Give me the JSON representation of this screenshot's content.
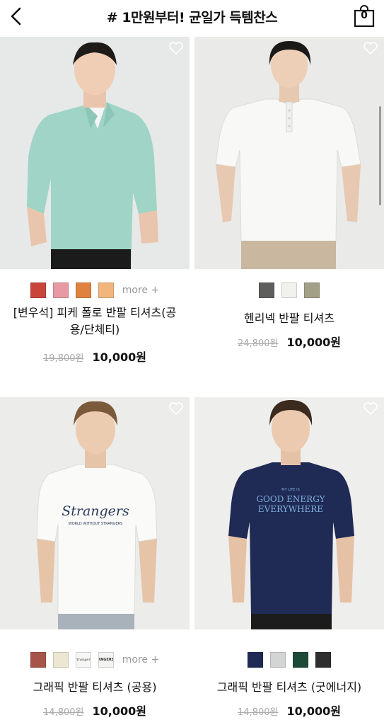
{
  "header": {
    "title": "# 1만원부터! 균일가 득템찬스",
    "cart_count": "0"
  },
  "products": [
    {
      "name": "[변우석] 피케 폴로 반팔 티셔츠(공용/단체티)",
      "original_price": "19,800원",
      "sale_price": "10,000원",
      "swatches": [
        "#c9453c",
        "#e79aa3",
        "#df8240",
        "#f2b57c"
      ],
      "more_label": "more +"
    },
    {
      "name": "헨리넥 반팔 티셔츠",
      "original_price": "24,800원",
      "sale_price": "10,000원",
      "swatches": [
        "#5e5f5d",
        "#f1f1ee",
        "#a3a088"
      ],
      "more_label": ""
    },
    {
      "name": "그래픽 반팔 티셔츠 (공용)",
      "original_price": "14,800원",
      "sale_price": "10,000원",
      "swatches": [
        "#a5554a",
        "#ece6d3",
        "#f6f6f4",
        "#f3f3f1"
      ],
      "swatch_texts": [
        "",
        "",
        "Strangers",
        "ANGERS"
      ],
      "more_label": "more +"
    },
    {
      "name": "그래픽 반팔 티셔츠 (굿에너지)",
      "original_price": "14,800원",
      "sale_price": "10,000원",
      "swatches": [
        "#1f2a55",
        "#d3d4d4",
        "#1b4a36",
        "#2e2e2e"
      ],
      "more_label": ""
    }
  ],
  "graphics": {
    "tee3_text": "Strangers",
    "tee3_subtext": "WORLD WITHOUT STRANGERS",
    "tee4_small": "MY LIFE IS",
    "tee4_line1": "GOOD ENERGY",
    "tee4_line2": "EVERYWHERE"
  }
}
